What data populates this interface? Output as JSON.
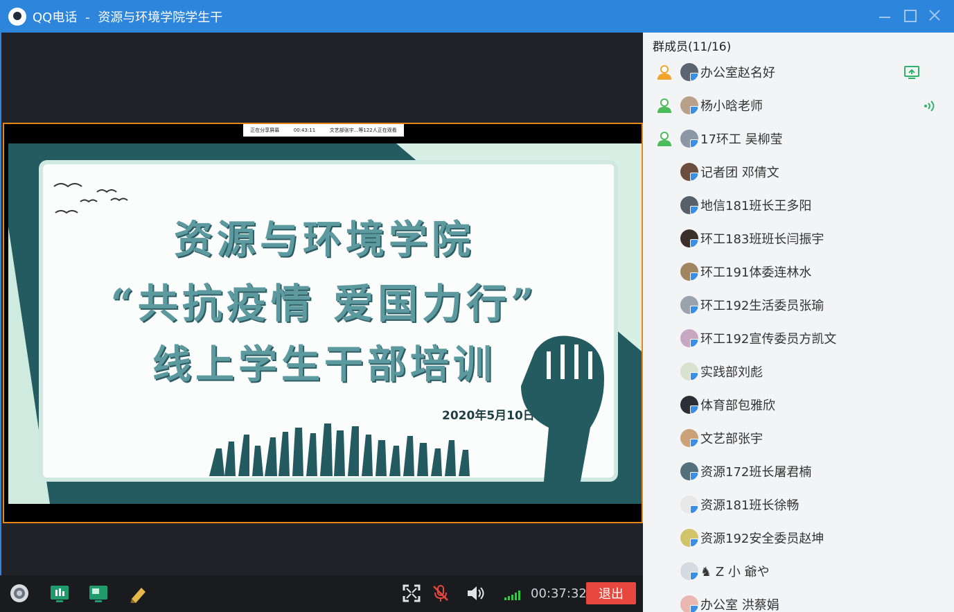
{
  "window": {
    "app_name": "QQ电话",
    "separator": "-",
    "group_name": "资源与环境学院学生干"
  },
  "share_bar": {
    "status": "正在分享屏幕",
    "duration": "00:43:11",
    "viewers": "文艺部张宇...等122人正在观看"
  },
  "slide": {
    "title_line1": "资源与环境学院",
    "title_line2": "“共抗疫情 爱国力行”",
    "title_line3": "线上学生干部培训",
    "date": "2020年5月10日"
  },
  "toolbar": {
    "timer": "00:37:32",
    "exit_label": "退出"
  },
  "members": {
    "header": "群成员(11/16)",
    "list": [
      {
        "name": "办公室赵名好",
        "role": "admin",
        "status": "screen-share"
      },
      {
        "name": "杨小晗老师",
        "role": "member",
        "status": "speaking"
      },
      {
        "name": "17环工 吴柳莹",
        "role": "member",
        "status": ""
      },
      {
        "name": "记者团 邓倩文",
        "role": "",
        "status": ""
      },
      {
        "name": "地信181班长王多阳",
        "role": "",
        "status": ""
      },
      {
        "name": "环工183班班长闫振宇",
        "role": "",
        "status": ""
      },
      {
        "name": "环工191体委连林水",
        "role": "",
        "status": ""
      },
      {
        "name": "环工192生活委员张瑜",
        "role": "",
        "status": ""
      },
      {
        "name": "环工192宣传委员方凯文",
        "role": "",
        "status": ""
      },
      {
        "name": "实践部刘彪",
        "role": "",
        "status": ""
      },
      {
        "name": "体育部包雅欣",
        "role": "",
        "status": ""
      },
      {
        "name": "文艺部张宇",
        "role": "",
        "status": ""
      },
      {
        "name": "资源172班长屠君楠",
        "role": "",
        "status": ""
      },
      {
        "name": "资源181班长徐畅",
        "role": "",
        "status": ""
      },
      {
        "name": "资源192安全委员赵坤",
        "role": "",
        "status": ""
      },
      {
        "name": "♞ Z 小 爺や",
        "role": "",
        "status": ""
      },
      {
        "name": "办公室 洪蔡娟",
        "role": "",
        "status": ""
      }
    ]
  },
  "colors": {
    "titlebar": "#2d86db",
    "share_border": "#e8861c",
    "exit_button": "#e8473e",
    "signal": "#2ecc40"
  }
}
